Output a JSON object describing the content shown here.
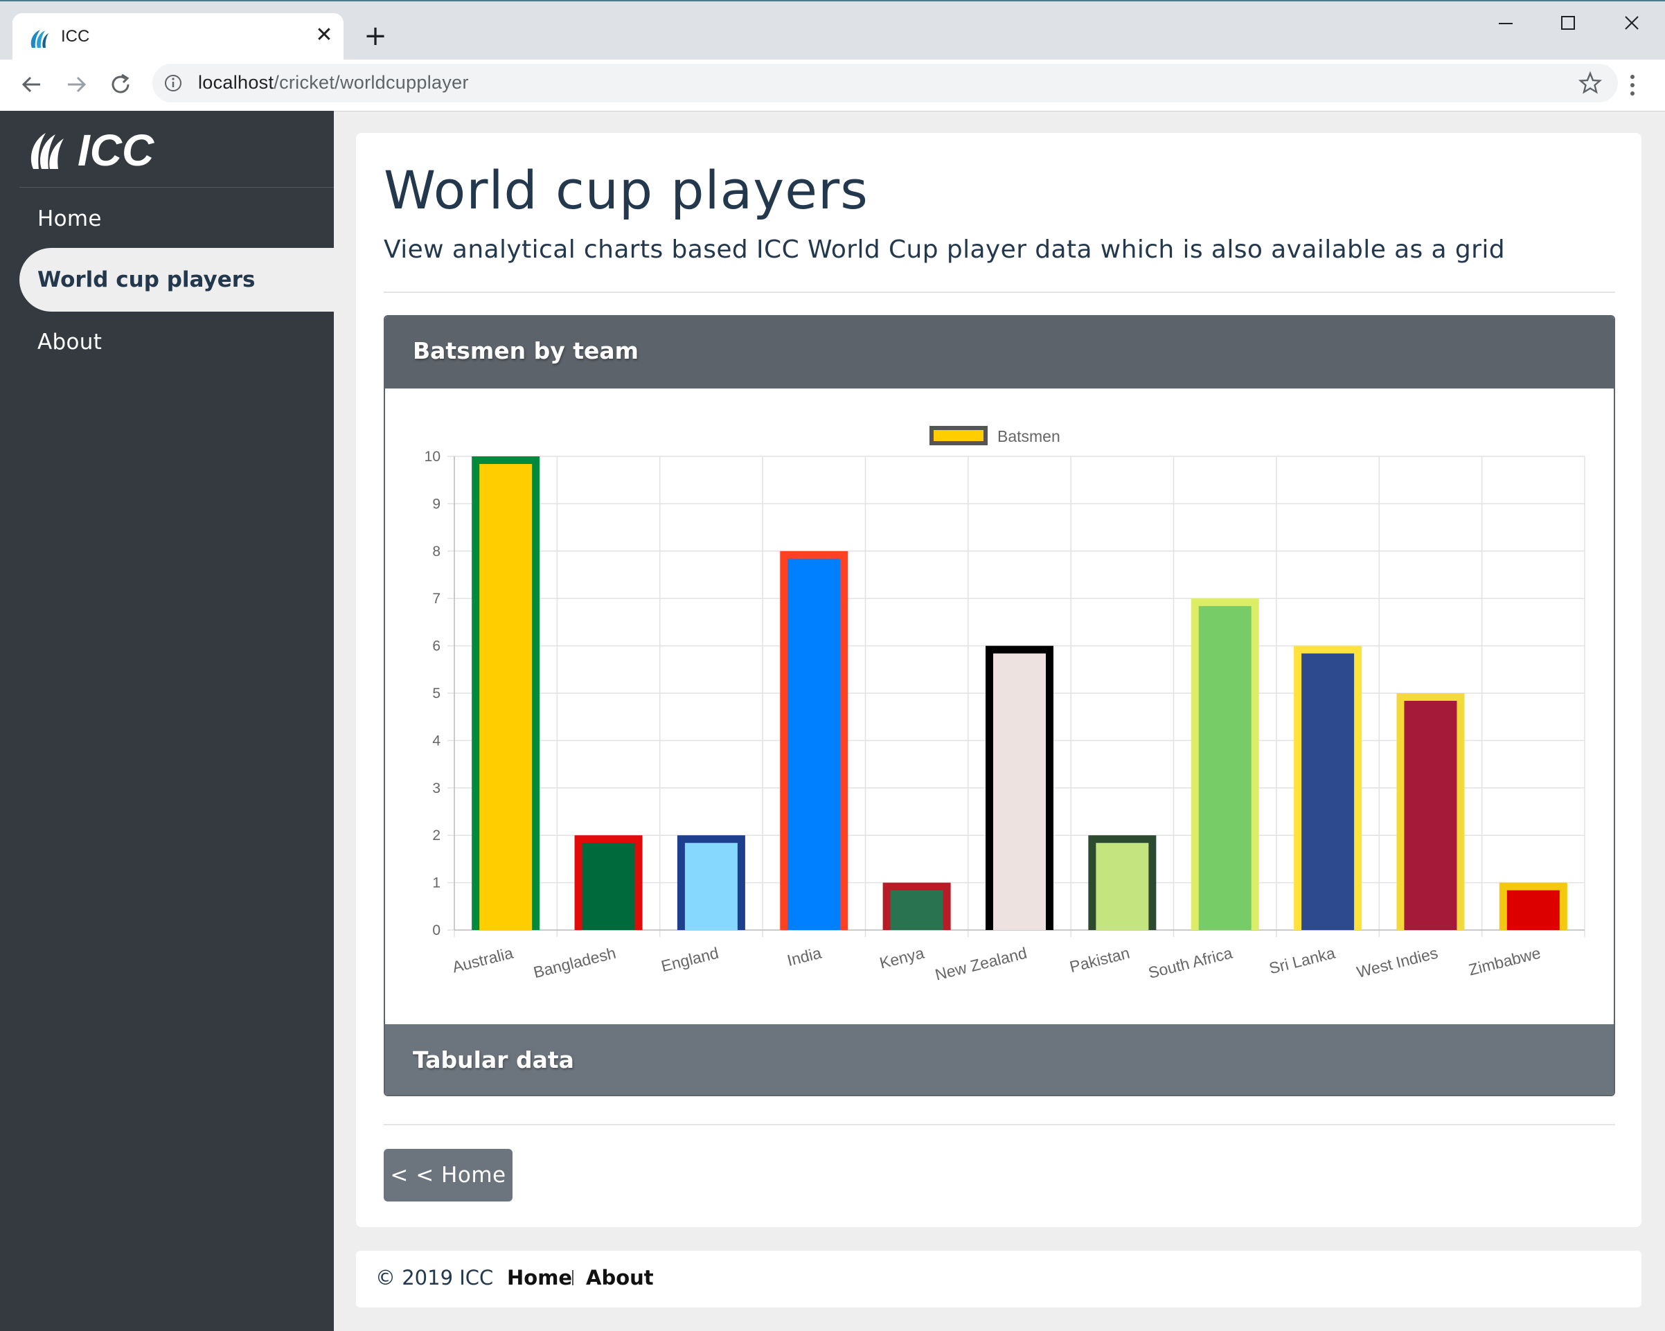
{
  "browser": {
    "tab_title": "ICC",
    "url_host": "localhost",
    "url_path": "/cricket/worldcupplayer"
  },
  "sidebar": {
    "brand": "ICC",
    "items": [
      {
        "label": "Home"
      },
      {
        "label": "World cup players"
      },
      {
        "label": "About"
      }
    ]
  },
  "main": {
    "title": "World cup players",
    "subtitle": "View analytical charts based ICC World Cup player data which is also available as a grid",
    "chart_panel_title": "Batsmen by team",
    "table_panel_title": "Tabular data",
    "home_button": "< < Home"
  },
  "footer": {
    "copyright": "© 2019 ICC",
    "links": [
      "Home",
      "About"
    ]
  },
  "chart_data": {
    "type": "bar",
    "categories": [
      "Australia",
      "Bangladesh",
      "England",
      "India",
      "Kenya",
      "New Zealand",
      "Pakistan",
      "South Africa",
      "Sri Lanka",
      "West Indies",
      "Zimbabwe"
    ],
    "series": [
      {
        "name": "Batsmen",
        "values": [
          10,
          2,
          2,
          8,
          1,
          6,
          2,
          7,
          6,
          5,
          1
        ],
        "fill_colors": [
          "#ffcd00",
          "#006a3c",
          "#87d8ff",
          "#0080ff",
          "#2a7350",
          "#ede2df",
          "#c3e47e",
          "#77cc68",
          "#2c4a8d",
          "#a51a38",
          "#dd0000"
        ],
        "border_colors": [
          "#008a3e",
          "#e30a0a",
          "#1e3f8e",
          "#ff4122",
          "#b81c27",
          "#000000",
          "#2c4a30",
          "#ddee66",
          "#ffe23a",
          "#f4d93a",
          "#f3c80d"
        ]
      }
    ],
    "legend": {
      "position": "top",
      "swatch_fill": "#ffcd00",
      "swatch_border": "#555555"
    },
    "ylim": [
      0,
      10
    ],
    "yticks": [
      0,
      1,
      2,
      3,
      4,
      5,
      6,
      7,
      8,
      9,
      10
    ],
    "grid": true
  }
}
